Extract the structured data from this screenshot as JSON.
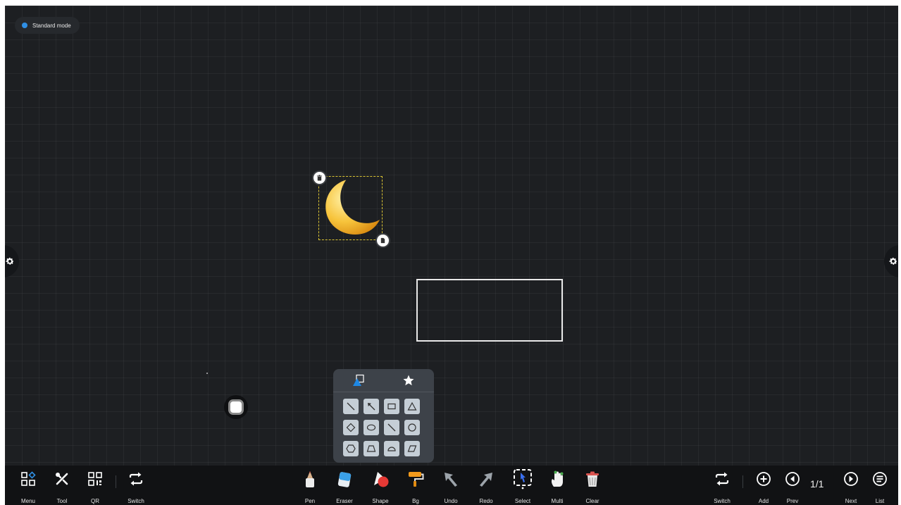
{
  "mode": {
    "label": "Standard mode",
    "dot_color": "#2f8fe4"
  },
  "canvas": {
    "background": "#1d1f22"
  },
  "shape_panel": {
    "tabs": [
      "shape-icon",
      "star-icon"
    ],
    "shapes": [
      "line",
      "arrow",
      "rectangle",
      "triangle",
      "diamond",
      "ellipse",
      "line",
      "circle",
      "hexagon",
      "trapezoid",
      "semicircle",
      "parallelogram"
    ]
  },
  "toolbar": {
    "left": {
      "menu": "Menu",
      "tool": "Tool",
      "qr": "QR",
      "switch": "Switch"
    },
    "center": {
      "pen": "Pen",
      "eraser": "Eraser",
      "shape": "Shape",
      "bg": "Bg",
      "undo": "Undo",
      "redo": "Redo",
      "select": "Select",
      "multi": "Multi",
      "clear": "Clear"
    },
    "right": {
      "switch": "Switch",
      "add": "Add",
      "prev": "Prev",
      "page": "1/1",
      "next": "Next",
      "list": "List"
    }
  }
}
